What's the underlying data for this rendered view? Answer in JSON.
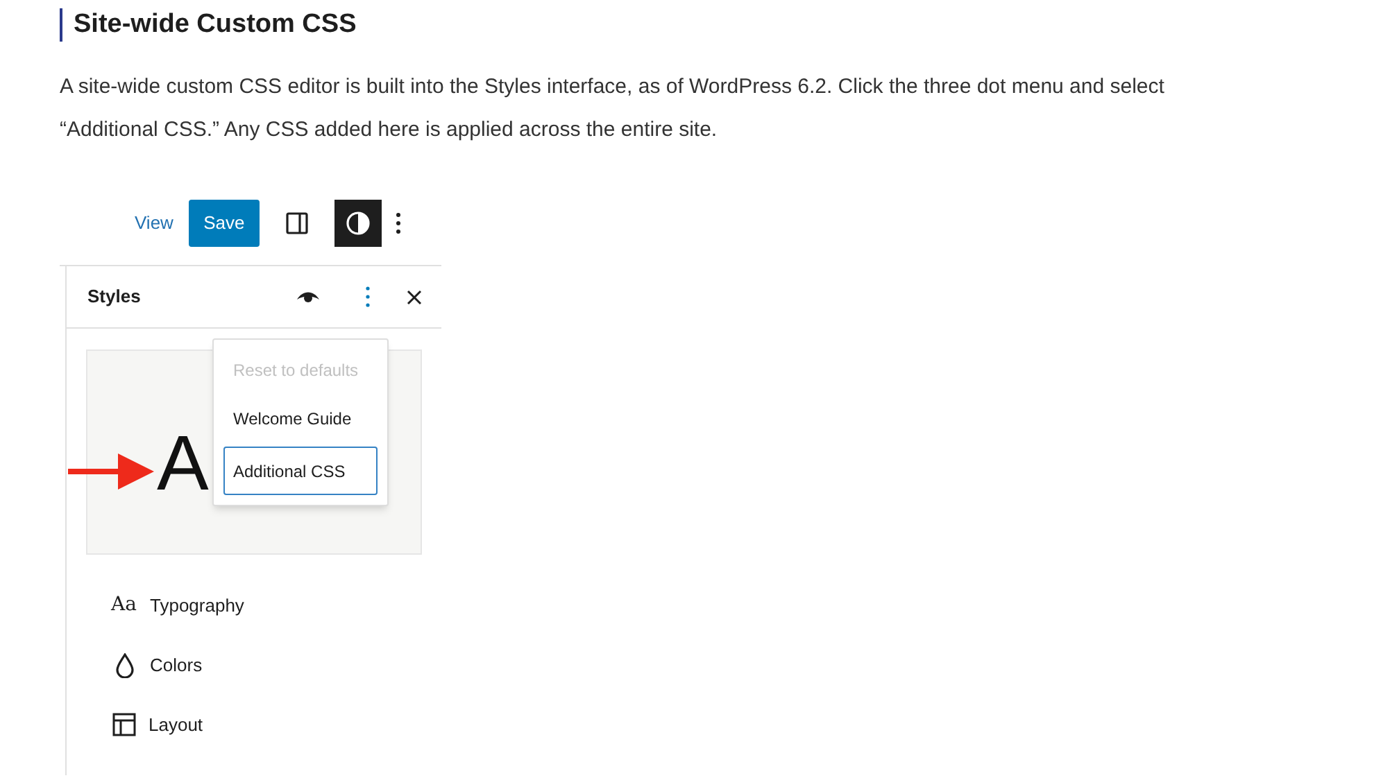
{
  "heading": "Site-wide Custom CSS",
  "paragraph": "A site-wide custom CSS editor is built into the Styles interface, as of WordPress 6.2. Click the three dot menu and select “Additional CSS.” Any CSS added here is applied across the entire site.",
  "toolbar": {
    "view": "View",
    "save": "Save",
    "style_toggle_on": true
  },
  "panel": {
    "title": "Styles",
    "preview": {
      "letter": "A"
    },
    "menu": [
      {
        "label": "Reset to defaults",
        "disabled": true,
        "selected": false
      },
      {
        "label": "Welcome Guide",
        "disabled": false,
        "selected": false
      },
      {
        "label": "Additional CSS",
        "disabled": false,
        "selected": true
      }
    ],
    "items": [
      {
        "kind": "typography",
        "icon_text": "Aa",
        "label": "Typography"
      },
      {
        "kind": "colors",
        "label": "Colors"
      },
      {
        "kind": "layout",
        "label": "Layout"
      }
    ]
  }
}
